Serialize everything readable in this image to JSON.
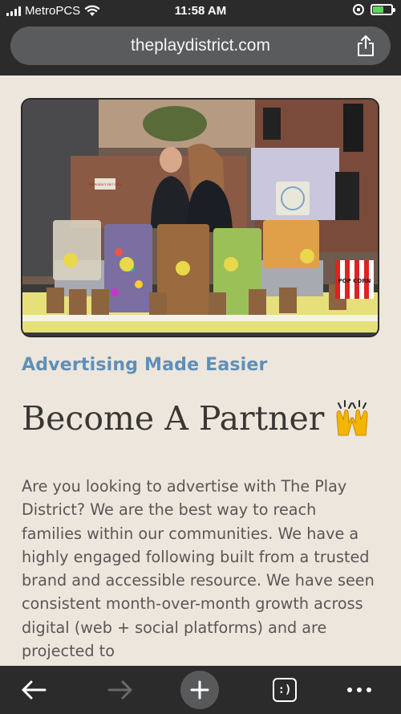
{
  "status": {
    "carrier": "MetroPCS",
    "time": "11:58 AM"
  },
  "browser": {
    "url": "theplaydistrict.com"
  },
  "page": {
    "eyebrow": "Advertising Made Easier",
    "headline": "Become A Partner",
    "body": "Are you looking to advertise with The Play District? We are the best way to reach families within our communities. We have a highly engaged following built from a trusted brand and accessible resource. We have seen consistent month-over-month growth across digital (web + social platforms) and are projected to"
  },
  "hero_image": {
    "sign_label": "EMERGENCY EXIT ONLY",
    "popcorn_box_label": "POP CORN"
  },
  "toolbar": {
    "tabs_glyph": ":)"
  },
  "colors": {
    "accent": "#5f8fb8",
    "heading": "#3a3633",
    "background": "#ece6dd",
    "chrome": "#2b2b2c"
  }
}
